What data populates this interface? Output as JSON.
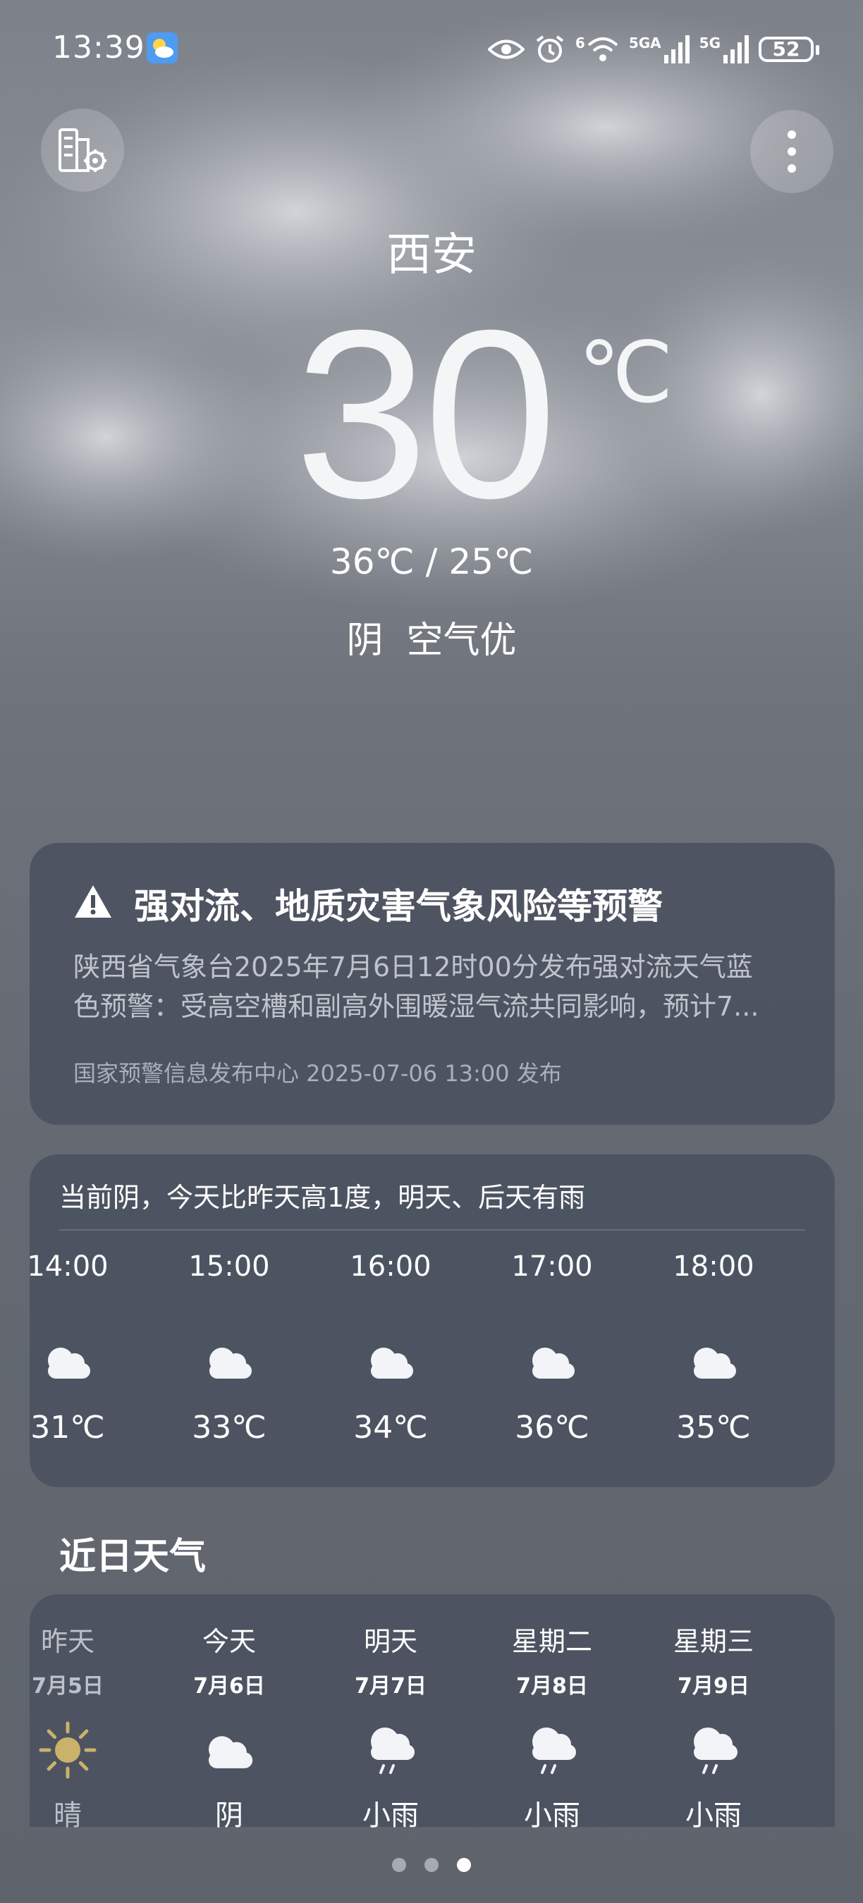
{
  "status_bar": {
    "time": "13:39",
    "network1": "6",
    "network1_type": "5GA",
    "network2_type": "5G",
    "battery": "52",
    "icons": [
      "weather-app-icon",
      "eye-icon",
      "alarm-icon",
      "wifi-icon",
      "signal-icon",
      "signal-icon"
    ]
  },
  "header": {
    "city": "西安",
    "temperature": "30",
    "unit": "℃",
    "range": "36℃ / 25℃",
    "condition": "阴  空气优"
  },
  "alert": {
    "title": "强对流、地质灾害气象风险等预警",
    "body_line1": "陕西省气象台2025年7月6日12时00分发布强对流天气蓝",
    "body_line2": "色预警：受高空槽和副高外围暖湿气流共同影响，预计7...",
    "source": "国家预警信息发布中心 2025-07-06 13:00 发布"
  },
  "hourly": {
    "summary": "当前阴，今天比昨天高1度，明天、后天有雨",
    "items": [
      {
        "time": "14:00",
        "icon": "cloudy-icon",
        "temp": "31℃"
      },
      {
        "time": "15:00",
        "icon": "cloudy-icon",
        "temp": "33℃"
      },
      {
        "time": "16:00",
        "icon": "cloudy-icon",
        "temp": "34℃"
      },
      {
        "time": "17:00",
        "icon": "cloudy-icon",
        "temp": "36℃"
      },
      {
        "time": "18:00",
        "icon": "cloudy-icon",
        "temp": "35℃"
      }
    ]
  },
  "daily": {
    "title": "近日天气",
    "items": [
      {
        "day": "昨天",
        "date": "7月5日",
        "icon": "sunny-icon",
        "cond": "晴"
      },
      {
        "day": "今天",
        "date": "7月6日",
        "icon": "cloudy-icon",
        "cond": "阴"
      },
      {
        "day": "明天",
        "date": "7月7日",
        "icon": "light-rain-icon",
        "cond": "小雨"
      },
      {
        "day": "星期二",
        "date": "7月8日",
        "icon": "light-rain-icon",
        "cond": "小雨"
      },
      {
        "day": "星期三",
        "date": "7月9日",
        "icon": "light-rain-icon",
        "cond": "小雨"
      }
    ]
  },
  "pager": {
    "count": 3,
    "active": 3
  }
}
